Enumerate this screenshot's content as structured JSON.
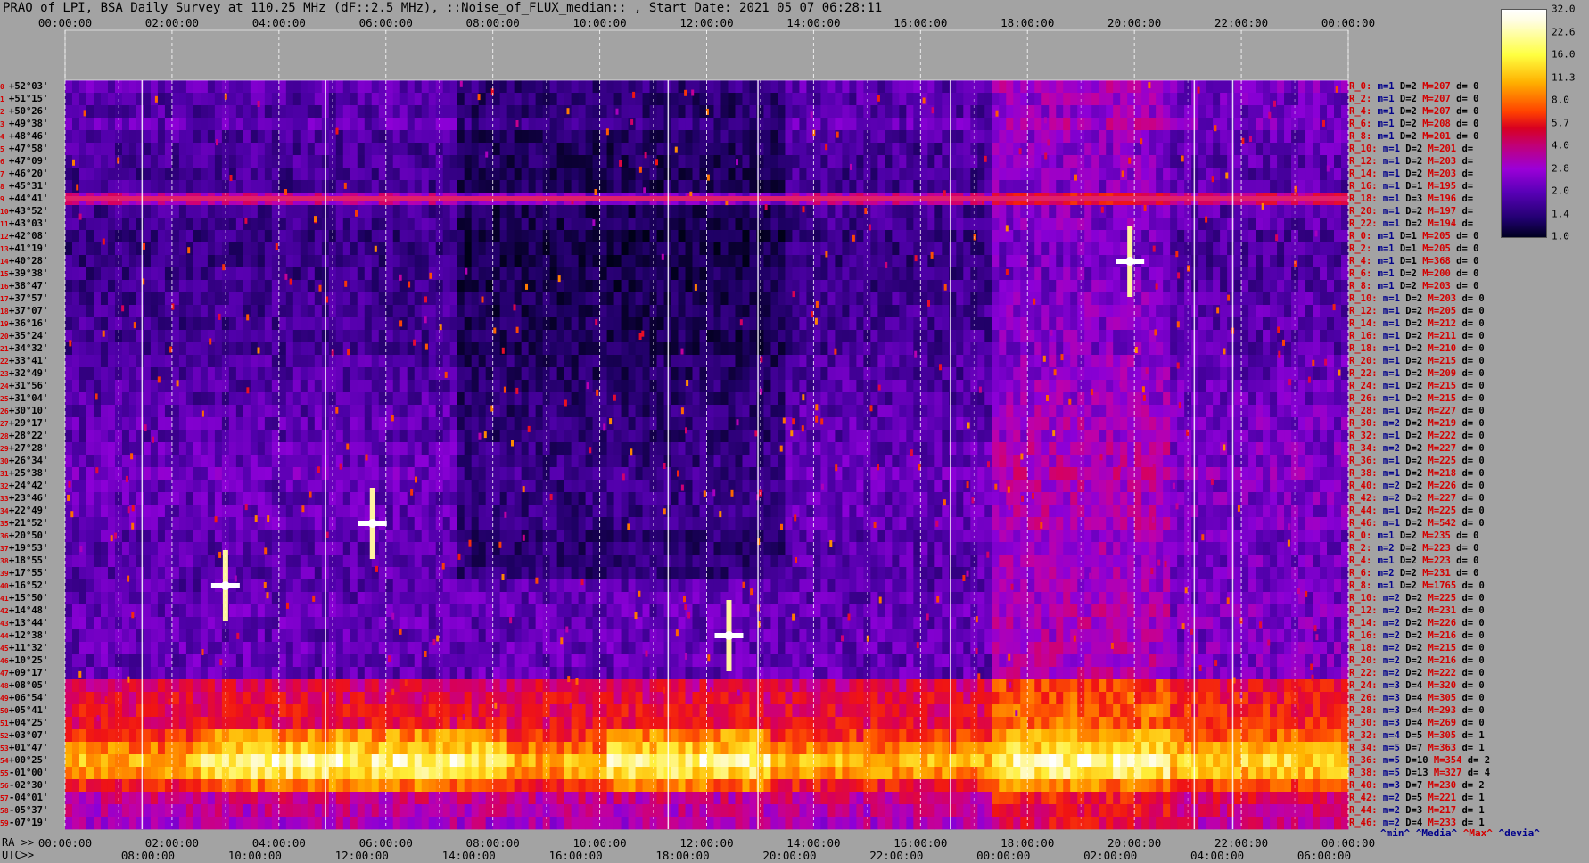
{
  "title": "PRAO of LPI, BSA Daily Survey at 110.25 MHz (dF::2.5 MHz), ::Noise_of_FLUX_median:: , Start Date: 2021 05 07 06:28:11",
  "top_axis_ticks": [
    "00:00:00",
    "02:00:00",
    "04:00:00",
    "06:00:00",
    "08:00:00",
    "10:00:00",
    "12:00:00",
    "14:00:00",
    "16:00:00",
    "18:00:00",
    "20:00:00",
    "22:00:00",
    "00:00:00"
  ],
  "bottom_ra_prefix": "RA >>",
  "bottom_ra_ticks": [
    "00:00:00",
    "02:00:00",
    "04:00:00",
    "06:00:00",
    "08:00:00",
    "10:00:00",
    "12:00:00",
    "14:00:00",
    "16:00:00",
    "18:00:00",
    "20:00:00",
    "22:00:00",
    "00:00:00"
  ],
  "bottom_utc_prefix": "UTC>>",
  "bottom_utc_ticks": [
    "08:00:00",
    "10:00:00",
    "12:00:00",
    "14:00:00",
    "16:00:00",
    "18:00:00",
    "20:00:00",
    "22:00:00",
    "00:00:00",
    "02:00:00",
    "04:00:00",
    "06:00:00"
  ],
  "colorbar": {
    "labels": [
      "32.0",
      "22.6",
      "16.0",
      "11.3",
      "8.0",
      "5.7",
      "4.0",
      "2.8",
      "2.0",
      "1.4",
      "1.0"
    ],
    "colors": [
      "#ffffff",
      "#ffff40",
      "#ffb000",
      "#ff4000",
      "#d80020",
      "#c0007a",
      "#9b00d8",
      "#5a00b8",
      "#20006e",
      "#000020"
    ]
  },
  "stats_legend": {
    "min": "^min^",
    "median": "^Media^",
    "max": "^Max^",
    "devia": "^devia^"
  },
  "rows": [
    {
      "idx": "0",
      "dec": "+52°03'",
      "side": "R_0:",
      "m": "m=1",
      "D": "D=2",
      "M": "M=207",
      "d": "d= 0"
    },
    {
      "idx": "1",
      "dec": "+51°15'",
      "side": "R_2:",
      "m": "m=1",
      "D": "D=2",
      "M": "M=207",
      "d": "d= 0"
    },
    {
      "idx": "2",
      "dec": "+50°26'",
      "side": "R_4:",
      "m": "m=1",
      "D": "D=2",
      "M": "M=207",
      "d": "d= 0"
    },
    {
      "idx": "3",
      "dec": "+49°38'",
      "side": "R_6:",
      "m": "m=1",
      "D": "D=2",
      "M": "M=208",
      "d": "d= 0"
    },
    {
      "idx": "4",
      "dec": "+48°46'",
      "side": "R_8:",
      "m": "m=1",
      "D": "D=2",
      "M": "M=201",
      "d": "d= 0"
    },
    {
      "idx": "5",
      "dec": "+47°58'",
      "side": "R_10:",
      "m": "m=1",
      "D": "D=2",
      "M": "M=201",
      "d": "d="
    },
    {
      "idx": "6",
      "dec": "+47°09'",
      "side": "R_12:",
      "m": "m=1",
      "D": "D=2",
      "M": "M=203",
      "d": "d="
    },
    {
      "idx": "7",
      "dec": "+46°20'",
      "side": "R_14:",
      "m": "m=1",
      "D": "D=2",
      "M": "M=203",
      "d": "d="
    },
    {
      "idx": "8",
      "dec": "+45°31'",
      "side": "R_16:",
      "m": "m=1",
      "D": "D=1",
      "M": "M=195",
      "d": "d="
    },
    {
      "idx": "9",
      "dec": "+44°41'",
      "side": "R_18:",
      "m": "m=1",
      "D": "D=3",
      "M": "M=196",
      "d": "d="
    },
    {
      "idx": "10",
      "dec": "+43°52'",
      "side": "R_20:",
      "m": "m=1",
      "D": "D=2",
      "M": "M=197",
      "d": "d="
    },
    {
      "idx": "11",
      "dec": "+43°03'",
      "side": "R_22:",
      "m": "m=1",
      "D": "D=2",
      "M": "M=194",
      "d": "d="
    },
    {
      "idx": "12",
      "dec": "+42°08'",
      "side": "R_0:",
      "m": "m=1",
      "D": "D=1",
      "M": "M=205",
      "d": "d= 0"
    },
    {
      "idx": "13",
      "dec": "+41°19'",
      "side": "R_2:",
      "m": "m=1",
      "D": "D=1",
      "M": "M=205",
      "d": "d= 0"
    },
    {
      "idx": "14",
      "dec": "+40°28'",
      "side": "R_4:",
      "m": "m=1",
      "D": "D=1",
      "M": "M=368",
      "d": "d= 0"
    },
    {
      "idx": "15",
      "dec": "+39°38'",
      "side": "R_6:",
      "m": "m=1",
      "D": "D=2",
      "M": "M=200",
      "d": "d= 0"
    },
    {
      "idx": "16",
      "dec": "+38°47'",
      "side": "R_8:",
      "m": "m=1",
      "D": "D=2",
      "M": "M=203",
      "d": "d= 0"
    },
    {
      "idx": "17",
      "dec": "+37°57'",
      "side": "R_10:",
      "m": "m=1",
      "D": "D=2",
      "M": "M=203",
      "d": "d= 0"
    },
    {
      "idx": "18",
      "dec": "+37°07'",
      "side": "R_12:",
      "m": "m=1",
      "D": "D=2",
      "M": "M=205",
      "d": "d= 0"
    },
    {
      "idx": "19",
      "dec": "+36°16'",
      "side": "R_14:",
      "m": "m=1",
      "D": "D=2",
      "M": "M=212",
      "d": "d= 0"
    },
    {
      "idx": "20",
      "dec": "+35°24'",
      "side": "R_16:",
      "m": "m=1",
      "D": "D=2",
      "M": "M=211",
      "d": "d= 0"
    },
    {
      "idx": "21",
      "dec": "+34°32'",
      "side": "R_18:",
      "m": "m=1",
      "D": "D=2",
      "M": "M=210",
      "d": "d= 0"
    },
    {
      "idx": "22",
      "dec": "+33°41'",
      "side": "R_20:",
      "m": "m=1",
      "D": "D=2",
      "M": "M=215",
      "d": "d= 0"
    },
    {
      "idx": "23",
      "dec": "+32°49'",
      "side": "R_22:",
      "m": "m=1",
      "D": "D=2",
      "M": "M=209",
      "d": "d= 0"
    },
    {
      "idx": "24",
      "dec": "+31°56'",
      "side": "R_24:",
      "m": "m=1",
      "D": "D=2",
      "M": "M=215",
      "d": "d= 0"
    },
    {
      "idx": "25",
      "dec": "+31°04'",
      "side": "R_26:",
      "m": "m=1",
      "D": "D=2",
      "M": "M=215",
      "d": "d= 0"
    },
    {
      "idx": "26",
      "dec": "+30°10'",
      "side": "R_28:",
      "m": "m=1",
      "D": "D=2",
      "M": "M=227",
      "d": "d= 0"
    },
    {
      "idx": "27",
      "dec": "+29°17'",
      "side": "R_30:",
      "m": "m=2",
      "D": "D=2",
      "M": "M=219",
      "d": "d= 0"
    },
    {
      "idx": "28",
      "dec": "+28°22'",
      "side": "R_32:",
      "m": "m=1",
      "D": "D=2",
      "M": "M=222",
      "d": "d= 0"
    },
    {
      "idx": "29",
      "dec": "+27°28'",
      "side": "R_34:",
      "m": "m=2",
      "D": "D=2",
      "M": "M=227",
      "d": "d= 0"
    },
    {
      "idx": "30",
      "dec": "+26°34'",
      "side": "R_36:",
      "m": "m=1",
      "D": "D=2",
      "M": "M=225",
      "d": "d= 0"
    },
    {
      "idx": "31",
      "dec": "+25°38'",
      "side": "R_38:",
      "m": "m=1",
      "D": "D=2",
      "M": "M=218",
      "d": "d= 0"
    },
    {
      "idx": "32",
      "dec": "+24°42'",
      "side": "R_40:",
      "m": "m=2",
      "D": "D=2",
      "M": "M=226",
      "d": "d= 0"
    },
    {
      "idx": "33",
      "dec": "+23°46'",
      "side": "R_42:",
      "m": "m=2",
      "D": "D=2",
      "M": "M=227",
      "d": "d= 0"
    },
    {
      "idx": "34",
      "dec": "+22°49'",
      "side": "R_44:",
      "m": "m=1",
      "D": "D=2",
      "M": "M=225",
      "d": "d= 0"
    },
    {
      "idx": "35",
      "dec": "+21°52'",
      "side": "R_46:",
      "m": "m=1",
      "D": "D=2",
      "M": "M=542",
      "d": "d= 0"
    },
    {
      "idx": "36",
      "dec": "+20°50'",
      "side": "R_0:",
      "m": "m=1",
      "D": "D=2",
      "M": "M=235",
      "d": "d= 0"
    },
    {
      "idx": "37",
      "dec": "+19°53'",
      "side": "R_2:",
      "m": "m=2",
      "D": "D=2",
      "M": "M=223",
      "d": "d= 0"
    },
    {
      "idx": "38",
      "dec": "+18°55'",
      "side": "R_4:",
      "m": "m=1",
      "D": "D=2",
      "M": "M=223",
      "d": "d= 0"
    },
    {
      "idx": "39",
      "dec": "+17°55'",
      "side": "R_6:",
      "m": "m=2",
      "D": "D=2",
      "M": "M=231",
      "d": "d= 0"
    },
    {
      "idx": "40",
      "dec": "+16°52'",
      "side": "R_8:",
      "m": "m=1",
      "D": "D=2",
      "M": "M=1765",
      "d": "d= 0"
    },
    {
      "idx": "41",
      "dec": "+15°50'",
      "side": "R_10:",
      "m": "m=2",
      "D": "D=2",
      "M": "M=225",
      "d": "d= 0"
    },
    {
      "idx": "42",
      "dec": "+14°48'",
      "side": "R_12:",
      "m": "m=2",
      "D": "D=2",
      "M": "M=231",
      "d": "d= 0"
    },
    {
      "idx": "43",
      "dec": "+13°44'",
      "side": "R_14:",
      "m": "m=2",
      "D": "D=2",
      "M": "M=226",
      "d": "d= 0"
    },
    {
      "idx": "44",
      "dec": "+12°38'",
      "side": "R_16:",
      "m": "m=2",
      "D": "D=2",
      "M": "M=216",
      "d": "d= 0"
    },
    {
      "idx": "45",
      "dec": "+11°32'",
      "side": "R_18:",
      "m": "m=2",
      "D": "D=2",
      "M": "M=215",
      "d": "d= 0"
    },
    {
      "idx": "46",
      "dec": "+10°25'",
      "side": "R_20:",
      "m": "m=2",
      "D": "D=2",
      "M": "M=216",
      "d": "d= 0"
    },
    {
      "idx": "47",
      "dec": "+09°17'",
      "side": "R_22:",
      "m": "m=2",
      "D": "D=2",
      "M": "M=222",
      "d": "d= 0"
    },
    {
      "idx": "48",
      "dec": "+08°05'",
      "side": "R_24:",
      "m": "m=3",
      "D": "D=4",
      "M": "M=320",
      "d": "d= 0"
    },
    {
      "idx": "49",
      "dec": "+06°54'",
      "side": "R_26:",
      "m": "m=3",
      "D": "D=4",
      "M": "M=305",
      "d": "d= 0"
    },
    {
      "idx": "50",
      "dec": "+05°41'",
      "side": "R_28:",
      "m": "m=3",
      "D": "D=4",
      "M": "M=293",
      "d": "d= 0"
    },
    {
      "idx": "51",
      "dec": "+04°25'",
      "side": "R_30:",
      "m": "m=3",
      "D": "D=4",
      "M": "M=269",
      "d": "d= 0"
    },
    {
      "idx": "52",
      "dec": "+03°07'",
      "side": "R_32:",
      "m": "m=4",
      "D": "D=5",
      "M": "M=305",
      "d": "d= 1"
    },
    {
      "idx": "53",
      "dec": "+01°47'",
      "side": "R_34:",
      "m": "m=5",
      "D": "D=7",
      "M": "M=363",
      "d": "d= 1"
    },
    {
      "idx": "54",
      "dec": "+00°25'",
      "side": "R_36:",
      "m": "m=5",
      "D": "D=10",
      "M": "M=354",
      "d": "d= 2"
    },
    {
      "idx": "55",
      "dec": "-01°00'",
      "side": "R_38:",
      "m": "m=5",
      "D": "D=13",
      "M": "M=327",
      "d": "d= 4"
    },
    {
      "idx": "56",
      "dec": "-02°30'",
      "side": "R_40:",
      "m": "m=3",
      "D": "D=7",
      "M": "M=230",
      "d": "d= 2"
    },
    {
      "idx": "57",
      "dec": "-04°01'",
      "side": "R_42:",
      "m": "m=2",
      "D": "D=5",
      "M": "M=221",
      "d": "d= 1"
    },
    {
      "idx": "58",
      "dec": "-05°37'",
      "side": "R_44:",
      "m": "m=2",
      "D": "D=3",
      "M": "M=217",
      "d": "d= 1"
    },
    {
      "idx": "59",
      "dec": "-07°19'",
      "side": "R_46:",
      "m": "m=2",
      "D": "D=4",
      "M": "M=233",
      "d": "d= 1"
    }
  ],
  "chart_data": {
    "type": "heatmap",
    "title": "PRAO of LPI, BSA Daily Survey at 110.25 MHz (dF::2.5 MHz), ::Noise_of_FLUX_median:: , Start Date: 2021 05 07 06:28:11",
    "x_axis": "RA 00:00:00 to 00:00:00 (24h); UTC 06:28:11 start",
    "y_axis": "Declination +52°03' to -07°19'",
    "color_scale": {
      "min": 1.0,
      "max": 32.0,
      "scale": "log2"
    },
    "row_median_levels": [
      2.5,
      2.3,
      2.3,
      2.6,
      2.2,
      2.1,
      2.1,
      2.0,
      2.0,
      4.5,
      2.0,
      2.0,
      1.8,
      1.8,
      1.8,
      1.9,
      1.9,
      2.0,
      2.0,
      2.0,
      2.0,
      2.0,
      2.2,
      2.2,
      2.3,
      2.3,
      2.4,
      2.5,
      2.4,
      2.6,
      2.6,
      2.8,
      2.6,
      2.6,
      2.6,
      2.6,
      2.4,
      2.4,
      2.4,
      2.4,
      2.4,
      2.5,
      2.6,
      2.6,
      2.5,
      2.6,
      2.6,
      2.6,
      6.0,
      6.5,
      7.0,
      7.0,
      9.0,
      12.0,
      16.0,
      14.0,
      8.0,
      5.0,
      4.5,
      4.2
    ],
    "bright_sources": [
      {
        "ra": "03:00:00",
        "dec": "+16°52'"
      },
      {
        "ra": "19:55:00",
        "dec": "+40°28'"
      },
      {
        "ra": "05:45:00",
        "dec": "+21°52'"
      },
      {
        "ra": "12:25:00",
        "dec": "+12°38'"
      }
    ]
  }
}
